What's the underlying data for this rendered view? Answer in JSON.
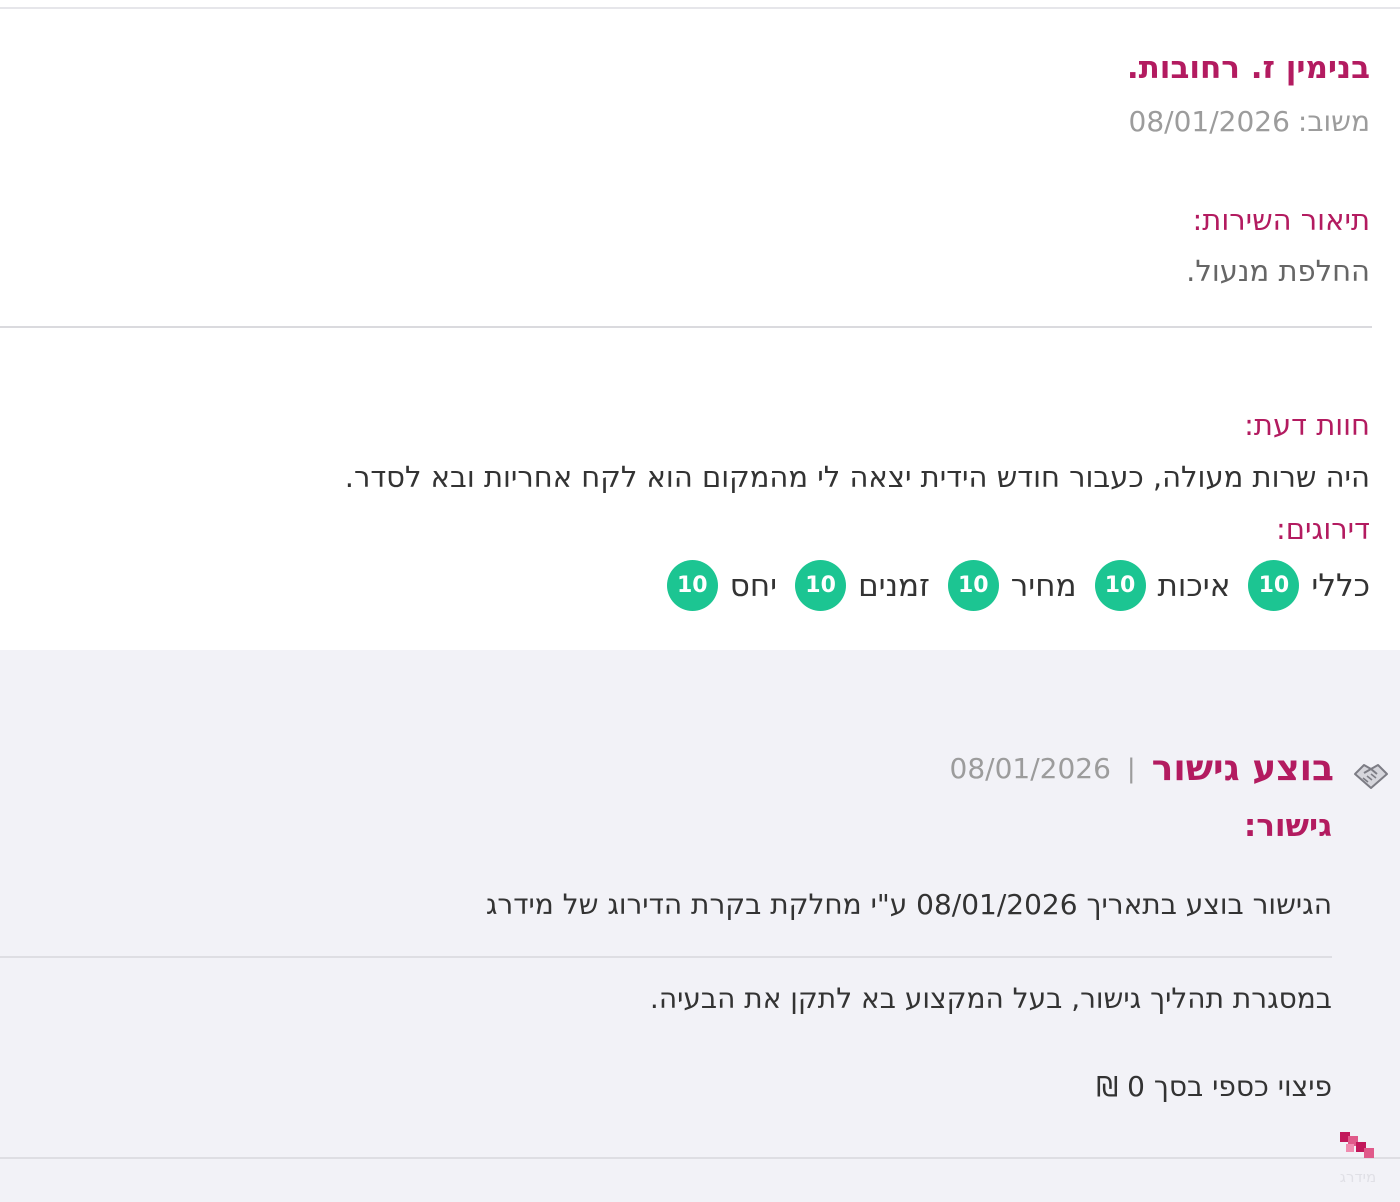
{
  "review": {
    "reviewer_name": "בנימין ז. רחובות.",
    "date_label": "משוב:",
    "date_value": "08/01/2026",
    "service_title": "תיאור השירות:",
    "service_text": "החלפת מנעול.",
    "opinion_title": "חוות דעת:",
    "opinion_text": "היה שרות מעולה, כעבור חודש הידית יצאה לי מהמקום הוא לקח אחריות ובא לסדר.",
    "ratings_title": "דירוגים:",
    "ratings": [
      {
        "label": "כללי",
        "value": "10"
      },
      {
        "label": "איכות",
        "value": "10"
      },
      {
        "label": "מחיר",
        "value": "10"
      },
      {
        "label": "זמנים",
        "value": "10"
      },
      {
        "label": "יחס",
        "value": "10"
      }
    ],
    "rating_badge_color": "#1cc592"
  },
  "mediation": {
    "title": "בוצע גישור",
    "separator": "|",
    "date": "08/01/2026",
    "subtitle": "גישור:",
    "line1": "הגישור בוצע בתאריך 08/01/2026 ע\"י מחלקת בקרת הדירוג של מידרג",
    "line2": "במסגרת תהליך גישור, בעל המקצוע בא לתקן את הבעיה.",
    "line3": "פיצוי כספי בסך 0 ₪",
    "icon": "handshake-icon"
  },
  "logo": {
    "text": "מידרג"
  },
  "colors": {
    "accent": "#b31b60",
    "muted": "#9c9c9c",
    "section_bg": "#f2f2f7"
  }
}
